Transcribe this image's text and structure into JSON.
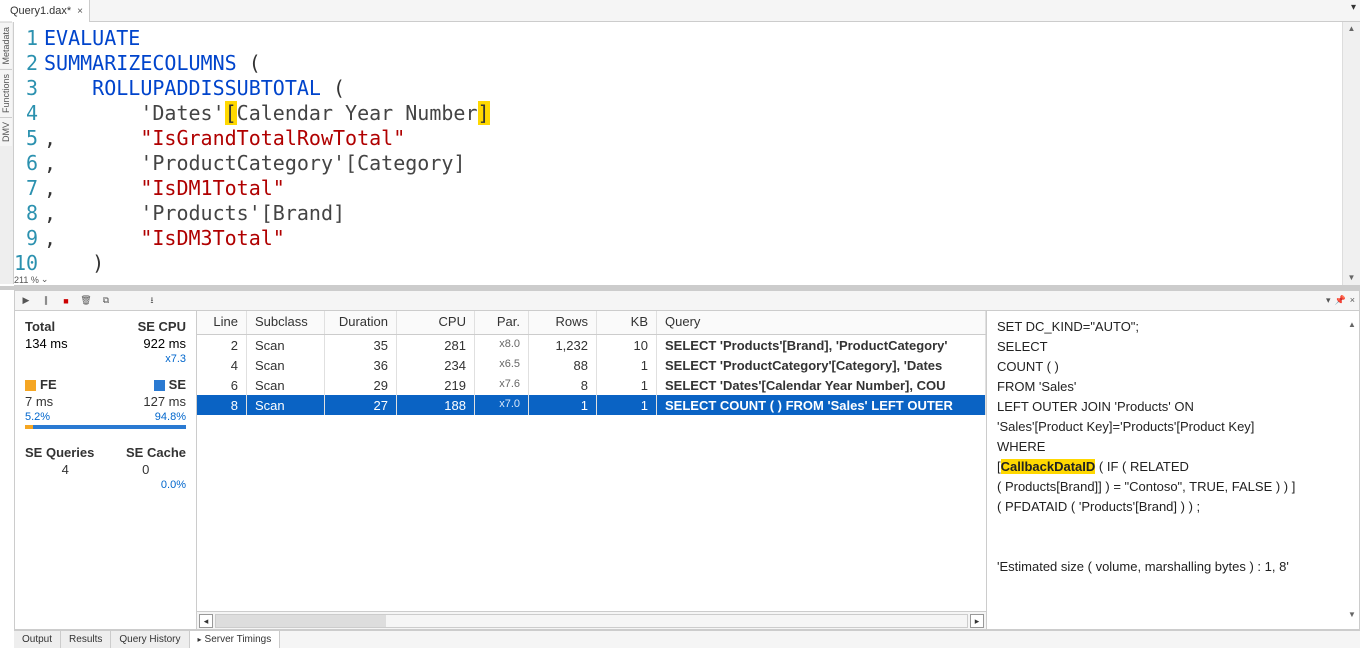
{
  "tab": {
    "title": "Query1.dax*",
    "close": "×"
  },
  "side_tabs": [
    "Metadata",
    "Functions",
    "DMV"
  ],
  "zoom": "211 %",
  "code": {
    "lines": [
      "1",
      "2",
      "3",
      "4",
      "5",
      "6",
      "7",
      "8",
      "9",
      "10"
    ],
    "l1": "EVALUATE",
    "l2a": "SUMMARIZECOLUMNS",
    "l2b": " (",
    "l3a": "    ",
    "l3b": "ROLLUPADDISSUBTOTAL",
    "l3c": " (",
    "l4a": "        ",
    "l4b": "'Dates'",
    "l4c": "[",
    "l4d": "Calendar Year Number",
    "l4e": "]",
    "l5a": ",       ",
    "l5b": "\"IsGrandTotalRowTotal\"",
    "l6a": ",       ",
    "l6b": "'ProductCategory'",
    "l6c": "[Category]",
    "l7a": ",       ",
    "l7b": "\"IsDM1Total\"",
    "l8a": ",       ",
    "l8b": "'Products'",
    "l8c": "[Brand]",
    "l9a": ",       ",
    "l9b": "\"IsDM3Total\"",
    "l10": "    )"
  },
  "stats": {
    "total_label": "Total",
    "total_val": "134 ms",
    "secpu_label": "SE CPU",
    "secpu_val": "922 ms",
    "secpu_x": "x7.3",
    "fe_label": "FE",
    "fe_val": "7 ms",
    "fe_pct": "5.2%",
    "se_label": "SE",
    "se_val": "127 ms",
    "se_pct": "94.8%",
    "seq_label": "SE Queries",
    "seq_val": "4",
    "sec_label": "SE Cache",
    "sec_val": "0",
    "sec_pct": "0.0%"
  },
  "grid": {
    "headers": {
      "line": "Line",
      "sub": "Subclass",
      "dur": "Duration",
      "cpu": "CPU",
      "par": "Par.",
      "rows": "Rows",
      "kb": "KB",
      "q": "Query"
    },
    "rows": [
      {
        "line": "2",
        "sub": "Scan",
        "dur": "35",
        "cpu": "281",
        "par": "x8.0",
        "rows": "1,232",
        "kb": "10",
        "q": "SELECT 'Products'[Brand], 'ProductCategory'",
        "sel": false
      },
      {
        "line": "4",
        "sub": "Scan",
        "dur": "36",
        "cpu": "234",
        "par": "x6.5",
        "rows": "88",
        "kb": "1",
        "q": "SELECT 'ProductCategory'[Category], 'Dates",
        "sel": false
      },
      {
        "line": "6",
        "sub": "Scan",
        "dur": "29",
        "cpu": "219",
        "par": "x7.6",
        "rows": "8",
        "kb": "1",
        "q": "SELECT 'Dates'[Calendar Year Number], COU",
        "sel": false
      },
      {
        "line": "8",
        "sub": "Scan",
        "dur": "27",
        "cpu": "188",
        "par": "x7.0",
        "rows": "1",
        "kb": "1",
        "q": "SELECT COUNT (  )  FROM 'Sales' LEFT OUTER",
        "sel": true
      }
    ]
  },
  "sql": {
    "l1": "SET DC_KIND=\"AUTO\";",
    "l2": "SELECT",
    "l3": "COUNT (  )",
    "l4": "FROM 'Sales'",
    "l5": "            LEFT OUTER JOIN 'Products' ON",
    "l6": "'Sales'[Product Key]='Products'[Product Key]",
    "l7": "WHERE",
    "l8a": "            [",
    "l8b": "CallbackDataID",
    "l8c": " ( IF ( RELATED",
    "l9": "( Products[Brand]] ) = \"Contoso\", TRUE, FALSE )  ) ]",
    "l10": "( PFDATAID ( 'Products'[Brand] )  ) ;",
    "l11": "",
    "l12": "'Estimated size ( volume, marshalling bytes ) : 1, 8'"
  },
  "btabs": [
    "Output",
    "Results",
    "Query History",
    "Server Timings"
  ]
}
